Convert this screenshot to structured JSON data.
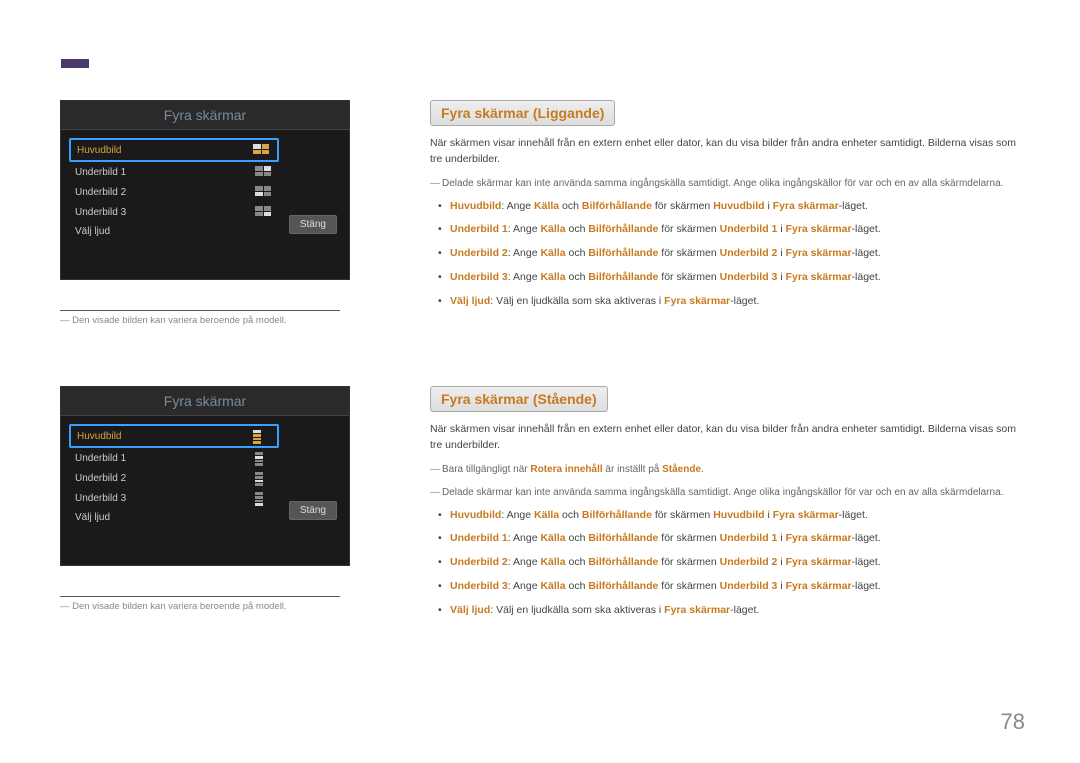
{
  "page_number": "78",
  "section_a": {
    "osd_title": "Fyra skärmar",
    "menu": {
      "item_main": "Huvudbild",
      "item_sub1": "Underbild 1",
      "item_sub2": "Underbild 2",
      "item_sub3": "Underbild 3",
      "item_audio": "Välj ljud"
    },
    "close": "Stäng",
    "footnote": "Den visade bilden kan variera beroende på modell.",
    "heading": "Fyra skärmar (Liggande)",
    "intro": "När skärmen visar innehåll från en extern enhet eller dator, kan du visa bilder från andra enheter samtidigt. Bilderna visas som tre underbilder.",
    "note1": "Delade skärmar kan inte använda samma ingångskälla samtidigt. Ange olika ingångskällor för var och en av alla skärmdelarna.",
    "bullets": {
      "b1": {
        "lead": "Huvudbild",
        "mid1": ": Ange ",
        "k1": "Källa",
        "mid2": " och ",
        "k2": "Bilförhållande",
        "mid3": " för skärmen ",
        "t": "Huvudbild",
        "mid4": " i ",
        "mode": "Fyra skärmar",
        "tail": "-läget."
      },
      "b2": {
        "lead": "Underbild 1",
        "mid1": ": Ange ",
        "k1": "Källa",
        "mid2": " och ",
        "k2": "Bilförhållande",
        "mid3": " för skärmen ",
        "t": "Underbild 1",
        "mid4": " i ",
        "mode": "Fyra skärmar",
        "tail": "-läget."
      },
      "b3": {
        "lead": "Underbild 2",
        "mid1": ": Ange ",
        "k1": "Källa",
        "mid2": " och ",
        "k2": "Bilförhållande",
        "mid3": " för skärmen ",
        "t": "Underbild 2",
        "mid4": " i ",
        "mode": "Fyra skärmar",
        "tail": "-läget."
      },
      "b4": {
        "lead": "Underbild 3",
        "mid1": ": Ange ",
        "k1": "Källa",
        "mid2": " och ",
        "k2": "Bilförhållande",
        "mid3": " för skärmen ",
        "t": "Underbild 3",
        "mid4": " i ",
        "mode": "Fyra skärmar",
        "tail": "-läget."
      },
      "b5": {
        "lead": "Välj ljud",
        "plain": ": Välj en ljudkälla som ska aktiveras i ",
        "mode": "Fyra skärmar",
        "tail": "-läget."
      }
    }
  },
  "section_b": {
    "osd_title": "Fyra skärmar",
    "menu": {
      "item_main": "Huvudbild",
      "item_sub1": "Underbild 1",
      "item_sub2": "Underbild 2",
      "item_sub3": "Underbild 3",
      "item_audio": "Välj ljud"
    },
    "close": "Stäng",
    "footnote": "Den visade bilden kan variera beroende på modell.",
    "heading": "Fyra skärmar (Stående)",
    "intro": "När skärmen visar innehåll från en extern enhet eller dator, kan du visa bilder från andra enheter samtidigt. Bilderna visas som tre underbilder.",
    "note_avail_pre": "Bara tillgängligt när ",
    "note_avail_k": "Rotera innehåll",
    "note_avail_mid": " är inställt på ",
    "note_avail_v": "Stående",
    "note_avail_tail": ".",
    "note1": "Delade skärmar kan inte använda samma ingångskälla samtidigt. Ange olika ingångskällor för var och en av alla skärmdelarna.",
    "bullets": {
      "b1": {
        "lead": "Huvudbild",
        "mid1": ": Ange ",
        "k1": "Källa",
        "mid2": " och ",
        "k2": "Bilförhållande",
        "mid3": " för skärmen ",
        "t": "Huvudbild",
        "mid4": " i ",
        "mode": "Fyra skärmar",
        "tail": "-läget."
      },
      "b2": {
        "lead": "Underbild 1",
        "mid1": ": Ange ",
        "k1": "Källa",
        "mid2": " och ",
        "k2": "Bilförhållande",
        "mid3": " för skärmen ",
        "t": "Underbild 1",
        "mid4": " i ",
        "mode": "Fyra skärmar",
        "tail": "-läget."
      },
      "b3": {
        "lead": "Underbild 2",
        "mid1": ": Ange ",
        "k1": "Källa",
        "mid2": " och ",
        "k2": "Bilförhållande",
        "mid3": " för skärmen ",
        "t": "Underbild 2",
        "mid4": " i ",
        "mode": "Fyra skärmar",
        "tail": "-läget."
      },
      "b4": {
        "lead": "Underbild 3",
        "mid1": ": Ange ",
        "k1": "Källa",
        "mid2": " och ",
        "k2": "Bilförhållande",
        "mid3": " för skärmen ",
        "t": "Underbild 3",
        "mid4": " i ",
        "mode": "Fyra skärmar",
        "tail": "-läget."
      },
      "b5": {
        "lead": "Välj ljud",
        "plain": ": Välj en ljudkälla som ska aktiveras i ",
        "mode": "Fyra skärmar",
        "tail": "-läget."
      }
    }
  }
}
